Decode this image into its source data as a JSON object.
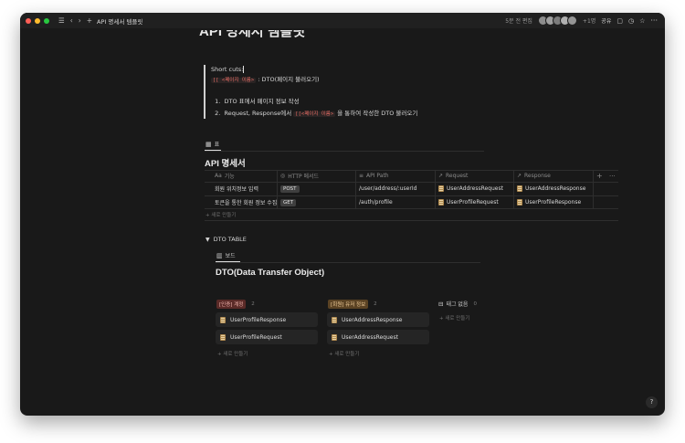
{
  "titlebar": {
    "page_title": "API 명세서 템플릿",
    "edited": "5분 전 편집",
    "extra_users": "+1명",
    "share": "공유"
  },
  "page": {
    "title_partial": "API 명세서 템플릿"
  },
  "callout": {
    "shortcuts_label": "Short cuts:",
    "shortcut_code": "[[ <페이지 이름>",
    "shortcut_desc": ": DTO(페이지 불러오기)",
    "list": [
      {
        "num": "1.",
        "text": "DTO 표에서 페이지 정보 작성"
      },
      {
        "num": "2.",
        "text_before": "Request, Response에서",
        "code": "[[<페이지 이름>",
        "text_after": "을 통하여 작성한 DTO 불러오기"
      }
    ]
  },
  "api_table": {
    "tab_label": "표",
    "title": "API 명세서",
    "columns": [
      "기능",
      "HTTP 메서드",
      "API Path",
      "Request",
      "Response"
    ],
    "rows": [
      {
        "feature": "회원 위치정보 입력",
        "method": "POST",
        "path": "/user/address/:userId",
        "request": "UserAddressRequest",
        "response": "UserAddressResponse"
      },
      {
        "feature": "토큰을 통한 회원 정보 수집",
        "method": "GET",
        "path": "/auth/profile",
        "request": "UserProfileRequest",
        "response": "UserProfileResponse"
      }
    ],
    "new_label": "새로 만들기"
  },
  "dto": {
    "toggle_label": "DTO TABLE",
    "tab_label": "보드",
    "title": "DTO(Data Transfer Object)",
    "groups": [
      {
        "label": "[인증] 계정",
        "count": "2",
        "color": "#5a2a27",
        "text_color": "#f0b4ad",
        "cards": [
          "UserProfileResponse",
          "UserProfileRequest"
        ],
        "new_label": "새로 만들기"
      },
      {
        "label": "[회원] 유저 정보",
        "count": "2",
        "color": "#5b4324",
        "text_color": "#f2cf9b",
        "cards": [
          "UserAddressResponse",
          "UserAddressRequest"
        ],
        "new_label": "새로 만들기"
      },
      {
        "label": "태그 없음",
        "count": "0",
        "cards": [],
        "new_label": "새로 만들기"
      }
    ]
  },
  "help": {
    "label": "?"
  },
  "colors": {
    "background": "#191919",
    "titlebar": "#202020",
    "code": "#e56b63"
  }
}
